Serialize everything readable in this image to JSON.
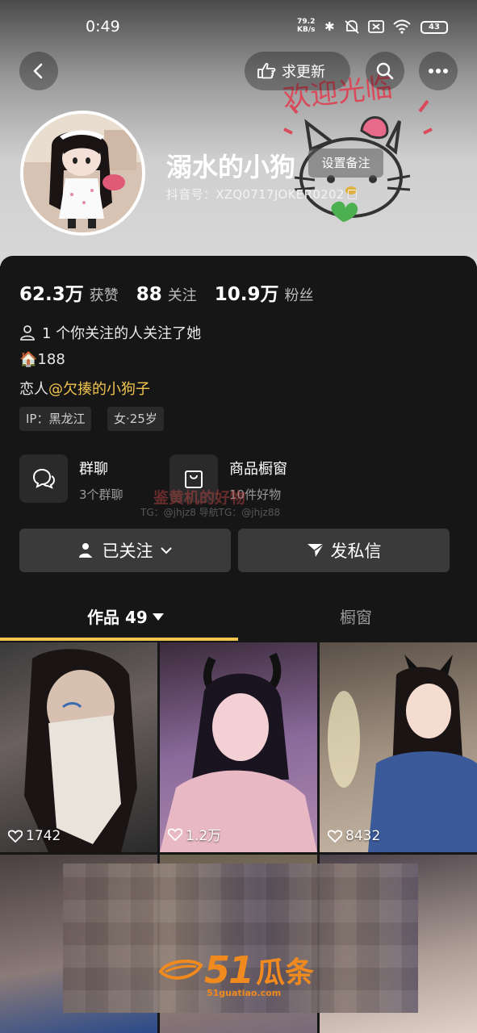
{
  "status_bar": {
    "time": "0:49",
    "net_speed_value": "79.2",
    "net_speed_unit": "KB/s",
    "battery": "43"
  },
  "header": {
    "update_request_label": "求更新",
    "nickname": "溺水的小狗",
    "set_remark_label": "设置备注",
    "douyin_id": "抖音号：XZQ0717JOKER0202",
    "deco_text": "欢迎光临"
  },
  "stats": [
    {
      "num": "62.3万",
      "label": "获赞"
    },
    {
      "num": "88",
      "label": "关注"
    },
    {
      "num": "10.9万",
      "label": "粉丝"
    }
  ],
  "profile": {
    "mutual_follow": "1 个你关注的人关注了她",
    "bio_line1": "🏠188",
    "bio_line2_prefix": "恋人",
    "bio_line2_mention": "@欠揍的小狗子",
    "tags": [
      "IP：黑龙江",
      "女·25岁"
    ]
  },
  "features": [
    {
      "title": "群聊",
      "sub": "3个群聊",
      "icon": "chat-bubbles-icon"
    },
    {
      "title": "商品橱窗",
      "sub": "10件好物",
      "icon": "shopping-bag-icon"
    }
  ],
  "watermark": {
    "line1": "鉴黄机的好物",
    "line2": "TG：@jhjz8 导航TG：@jhjz88"
  },
  "actions": {
    "follow_label": "已关注",
    "message_label": "发私信"
  },
  "tabs": {
    "works_label": "作品 49",
    "shop_label": "橱窗"
  },
  "videos": [
    {
      "likes": "1742"
    },
    {
      "likes": "1.2万"
    },
    {
      "likes": "8432"
    }
  ],
  "overlay_logo": {
    "text_num": "51",
    "text_cn": "瓜条",
    "url": "51guatiao.com"
  },
  "colors": {
    "accent": "#f2c54e",
    "card_bg": "#161616",
    "button_bg": "#3a3a3a"
  }
}
